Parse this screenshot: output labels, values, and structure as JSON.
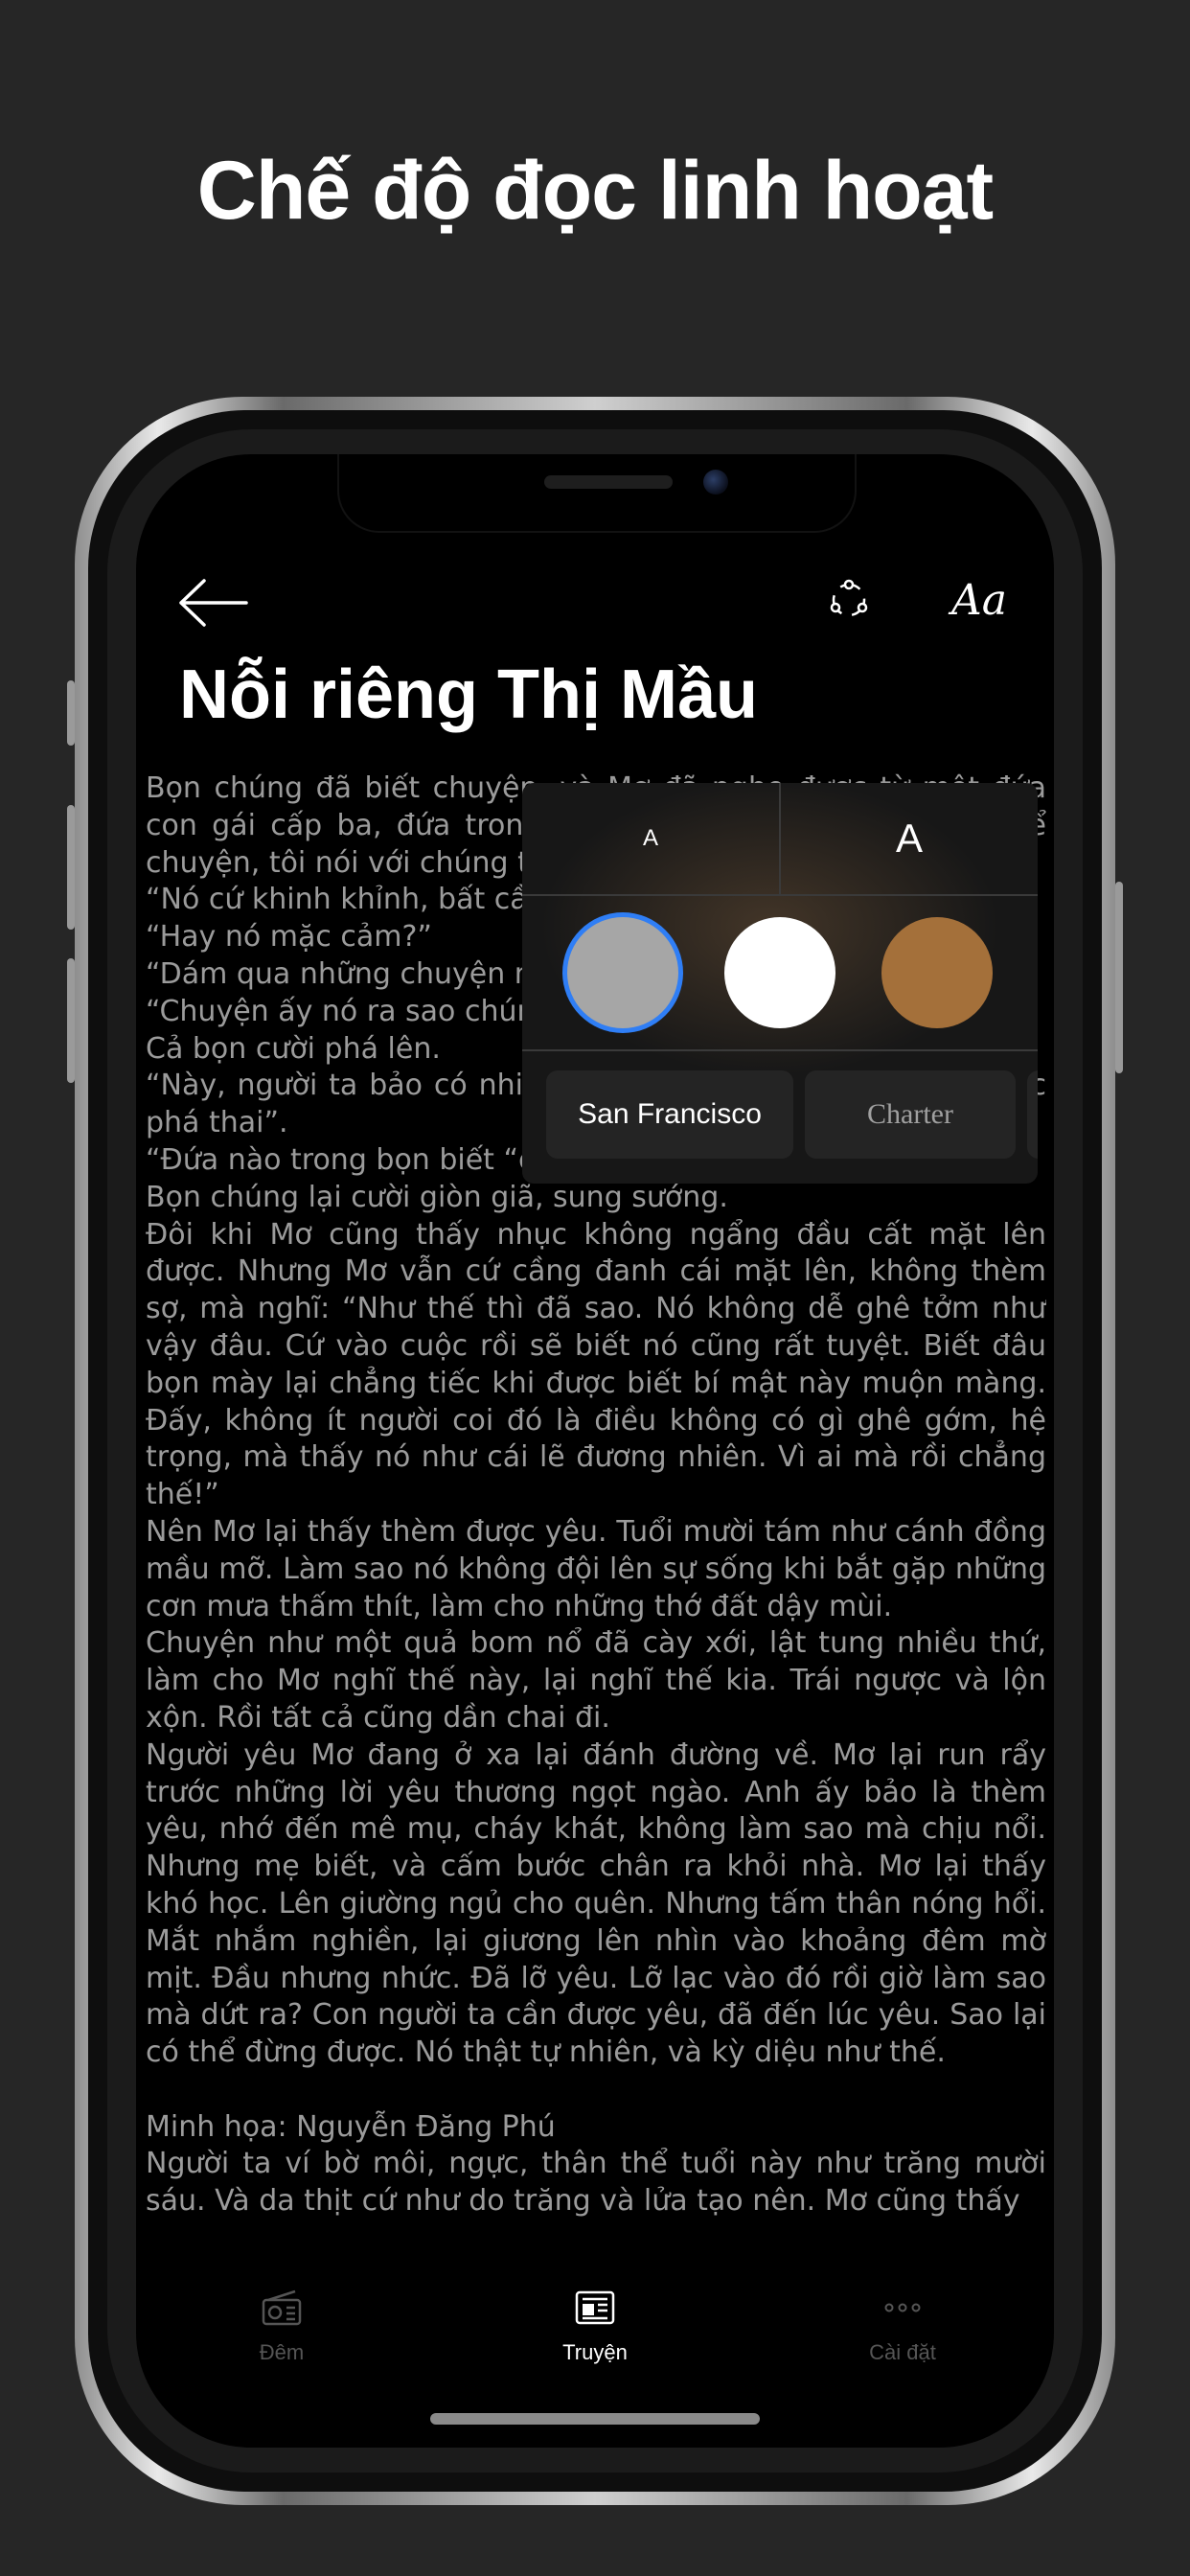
{
  "headline": "Chế độ đọc linh hoạt",
  "reader": {
    "story_title": "Nỗi riêng Thị Mầu",
    "paragraphs": [
      "Bọn chúng đã biết chuyện, và Mơ đã nghe được từ một đứa con gái cấp ba, đứa trong lớp vẫn hay leo lên bàn ngồi kể chuyện, tôi nói với chúng tôi chí:",
      "“Nó cứ khinh khỉnh, bất cần lắm”",
      "“Hay nó mặc cảm?”",
      "“Dám qua những chuyện như thế cơ mà”",
      "“Chuyện ấy nó ra sao chúng mình đều chưa biết”",
      "Cả bọn cười phá lên.",
      "“Này, người ta bảo có nhiều lắm, ngay cả học sinh trung học phá thai”.",
      "“Đứa nào trong bọn biết “chuyện ấy” thì giơ tay”.",
      "Bọn chúng lại cười giòn giã, sung sướng.",
      "Đôi khi Mơ cũng thấy nhục không ngẩng đầu cất mặt lên được. Nhưng Mơ vẫn cứ cầng đanh cái mặt lên, không thèm sợ, mà nghĩ: “Như thế thì đã sao. Nó không dễ ghê tởm như vậy đâu. Cứ vào cuộc rồi sẽ biết nó cũng rất tuyệt. Biết đâu bọn mày lại chẳng tiếc khi được biết bí mật này muộn màng. Đấy, không ít người coi đó là điều không có gì ghê gớm, hệ trọng, mà thấy nó như cái lẽ đương nhiên. Vì ai mà rồi chẳng thế!”",
      "Nên Mơ lại thấy thèm được yêu. Tuổi mười tám như cánh đồng mầu mỡ. Làm sao nó không đội lên sự sống khi bắt gặp những cơn mưa thấm thít, làm cho những thớ đất dậy mùi.",
      "Chuyện như một quả bom nổ đã cày xới, lật tung nhiều thứ, làm cho Mơ nghĩ thế này, lại nghĩ thế kia. Trái ngược và lộn xộn. Rồi tất cả cũng dần chai đi.",
      "Người yêu Mơ đang ở xa lại đánh đường về. Mơ lại run rẩy trước những lời yêu thương ngọt ngào. Anh ấy bảo là thèm yêu, nhớ đến mê mụ, cháy khát, không làm sao mà chịu nổi. Nhưng mẹ biết, và cấm bước chân ra khỏi nhà. Mơ lại thấy khó học. Lên giường ngủ cho quên. Nhưng tấm thân nóng hổi. Mắt nhắm nghiền, lại giương lên nhìn vào khoảng đêm mờ mịt. Đầu nhưng nhức. Đã lỡ yêu. Lỡ lạc vào đó rồi giờ làm sao mà dứt ra? Con người ta cần được yêu, đã đến lúc yêu. Sao lại có thể đừng được. Nó thật tự nhiên, và kỳ diệu như thế."
    ],
    "illustration_credit": "Minh họa: Nguyễn Đăng Phú",
    "after_credit": "Người ta ví bờ môi, ngực, thân thể tuổi này như trăng mười sáu. Và da thịt cứ như do trăng và lửa tạo nên. Mơ cũng thấy"
  },
  "settings_popover": {
    "font_size_small_label": "A",
    "font_size_large_label": "A",
    "theme_colors": [
      "#a6a6a6",
      "#ffffff",
      "#a4703a"
    ],
    "selected_theme_index": 0,
    "fonts": [
      "San Francisco",
      "Charter"
    ]
  },
  "topbar": {
    "aa_label": "Aa",
    "icons": [
      "back-arrow-icon",
      "share-icon",
      "text-settings-icon"
    ]
  },
  "tabbar": {
    "tabs": [
      {
        "label": "Đêm",
        "icon": "radio-icon",
        "active": false
      },
      {
        "label": "Truyện",
        "icon": "newspaper-icon",
        "active": true
      },
      {
        "label": "Cài đặt",
        "icon": "more-dots-icon",
        "active": false
      }
    ]
  },
  "colors": {
    "background": "#262626",
    "screen": "#000000",
    "body_text": "#9b9b9b",
    "accent_selection": "#2f7ef5",
    "tab_active": "#ffffff",
    "tab_inactive": "#555555"
  }
}
